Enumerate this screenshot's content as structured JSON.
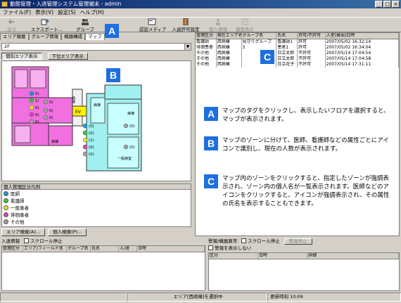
{
  "window": {
    "title": "動態管理・入退管理システム管理端末 - admin"
  },
  "menu": [
    "ファイル(F)",
    "表示(V)",
    "設定(S)",
    "ヘルプ(H)"
  ],
  "toolbar": {
    "items": [
      {
        "label": "戻る",
        "icon": "back-icon",
        "disabled": true
      },
      {
        "label": "エクスポート...",
        "icon": "export-icon",
        "disabled": false
      },
      {
        "label": "グループ",
        "icon": "group-icon",
        "disabled": false
      },
      {
        "label": "認証メディア",
        "icon": "card-icon",
        "disabled": false
      },
      {
        "label": "入退許可設定",
        "icon": "door-icon",
        "disabled": false
      },
      {
        "label": "個人情報",
        "icon": "person-icon",
        "disabled": true
      },
      {
        "label": "履歴表示",
        "icon": "history-icon",
        "disabled": true
      }
    ]
  },
  "tabs": [
    "エリア階層",
    "グループ情報",
    "機器構成",
    "マップ"
  ],
  "floor": {
    "selected": "2F"
  },
  "view_buttons": [
    "個別エリア表示",
    "下位エリア表示"
  ],
  "map": {
    "rooms": [
      "EV",
      "病棟",
      "病棟",
      "病棟",
      "病棟",
      "一般病室"
    ],
    "counts": [
      "0)",
      "1)",
      "0)",
      "0)",
      "0)",
      "0)",
      "0)",
      "0)",
      "(0)",
      "(0)",
      "(1)",
      "(0)",
      "(0)",
      "(0)",
      "(0)"
    ]
  },
  "legend": {
    "title": "個人管理区分凡例",
    "items": [
      {
        "label": "医師",
        "color": "#1a9bd6"
      },
      {
        "label": "看護師",
        "color": "#3cc83c"
      },
      {
        "label": "一般患者",
        "color": "#e8e820"
      },
      {
        "label": "徘徊患者",
        "color": "#e040c0"
      },
      {
        "label": "その他",
        "color": "#a0a0a0"
      }
    ]
  },
  "left_buttons": [
    "エリア検索(A)...",
    "個人検索(P)..."
  ],
  "list": {
    "headers": [
      "管理区分",
      "現在エリア名",
      "グループ名",
      "氏名",
      "許可/不許可",
      "入室(検出)日時"
    ],
    "rows": [
      [
        "看護師",
        "西病棟",
        "見守りグループ",
        "看護師1",
        "許可",
        "2007/05/02 16:32:14"
      ],
      [
        "徘徊患者",
        "西病棟",
        "3",
        "患者1",
        "許可",
        "2007/05/02 16:34:04"
      ],
      [
        "その他",
        "西病棟",
        "",
        "日立太郎",
        "不許可",
        "2007/05/14 17:04:54"
      ],
      [
        "その他",
        "西病棟",
        "",
        "日立太郎",
        "不許可",
        "2007/05/14 17:04:58"
      ],
      [
        "その他",
        "西病棟",
        "",
        "日立花子",
        "不許可",
        "2007/05/14 17:31:11"
      ]
    ]
  },
  "callouts": {
    "A": "マップのタグをクリックし、表示したいフロアを選択すると、マップが表示されます。",
    "B": "マップのゾーンに分けて、医師、看護師などの属性ごとにアイコンで識別し、現在の人数が表示されます。",
    "C": "マップ内のゾーンをクリックすると、指定したゾーンが強調表示され、ゾーン内の個人名が一覧表示されます。医師などのアイコンをクリックすると、アイコンが強調表示され、その属性の氏名を表示することもできます。"
  },
  "entry_panel": {
    "title": "入退情報",
    "scroll_stop": "スクロール停止",
    "headers": [
      "管理区分",
      "エリア/フィールド名",
      "グループ名",
      "氏名",
      "入/退",
      "日時"
    ]
  },
  "alarm_panel": {
    "title": "警報/機器異常",
    "scroll_stop": "スクロール停止",
    "alarm_stop": "警報停止",
    "hide_alarm": "警報を表示しない",
    "headers": [
      "区分",
      "日時",
      "詳細"
    ]
  },
  "status": {
    "message": "エリア[西病棟]を選択中",
    "update_label": "更新時刻",
    "update_time": "10:09"
  }
}
